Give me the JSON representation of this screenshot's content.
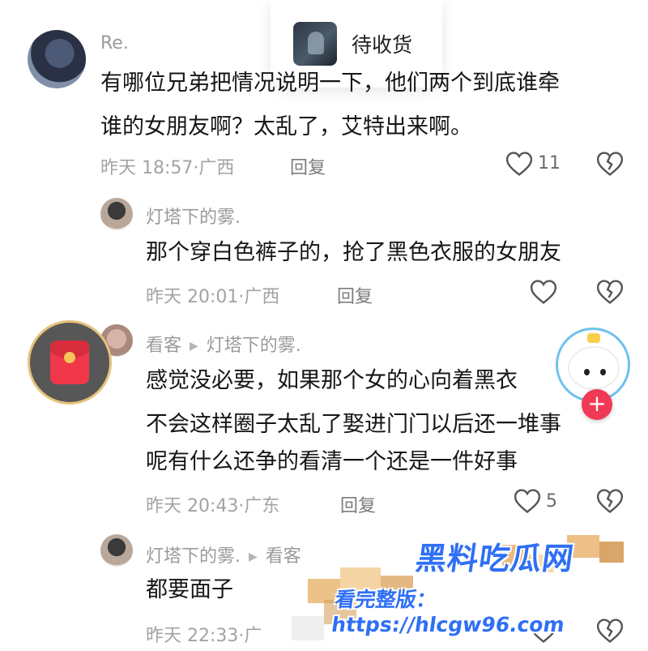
{
  "popup": {
    "label": "待收货",
    "thumb_icon": "product-thumbnail"
  },
  "comments": [
    {
      "user": "Re.",
      "lines": [
        "有哪位兄弟把情况说明一下，他们两个到底谁牵",
        "谁的女朋友啊？太乱了，艾特出来啊。"
      ],
      "time": "昨天 18:57",
      "location": "广西",
      "reply_label": "回复",
      "likes": "11"
    },
    {
      "user": "灯塔下的雾.",
      "lines": [
        "那个穿白色裤子的，抢了黑色衣服的女朋友"
      ],
      "time": "昨天 20:01",
      "location": "广西",
      "reply_label": "回复",
      "likes": ""
    },
    {
      "user": "看客",
      "reply_to": "灯塔下的雾.",
      "lines": [
        "感觉没必要，如果那个女的心向着黑衣",
        "不会这样圈子太乱了娶进门门以后还一堆事",
        "呢有什么还争的看清一个还是一件好事"
      ],
      "time": "昨天 20:43",
      "location": "广东",
      "reply_label": "回复",
      "likes": "5"
    },
    {
      "user": "灯塔下的雾.",
      "reply_to": "看客",
      "lines": [
        "都要面子"
      ],
      "time": "昨天 22:33",
      "location": "广",
      "reply_label": "",
      "likes": ""
    }
  ],
  "separator": "·",
  "watermark": {
    "title": "黑料吃瓜网",
    "url": "看完整版：https://hlcgw96.com"
  },
  "colors": {
    "accent_red": "#f03a55",
    "watermark_blue": "#2f6ff5",
    "meta_gray": "#a3a3a3"
  }
}
